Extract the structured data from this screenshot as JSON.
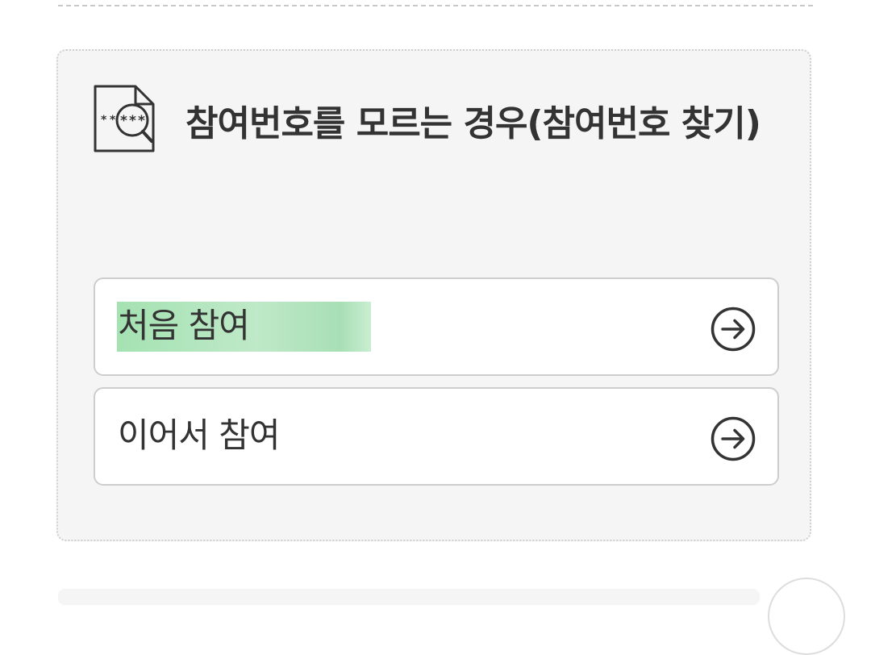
{
  "card": {
    "title": "참여번호를 모르는 경우(참여번호 찾기)",
    "icon": "document-search-icon"
  },
  "options": [
    {
      "label": "처음 참여",
      "icon": "arrow-right-circle-icon",
      "highlighted": true
    },
    {
      "label": "이어서 참여",
      "icon": "arrow-right-circle-icon",
      "highlighted": false
    }
  ],
  "colors": {
    "card_bg": "#f5f5f5",
    "text": "#333333",
    "highlight": "#b3e6bf",
    "border": "#cdcdcd"
  }
}
